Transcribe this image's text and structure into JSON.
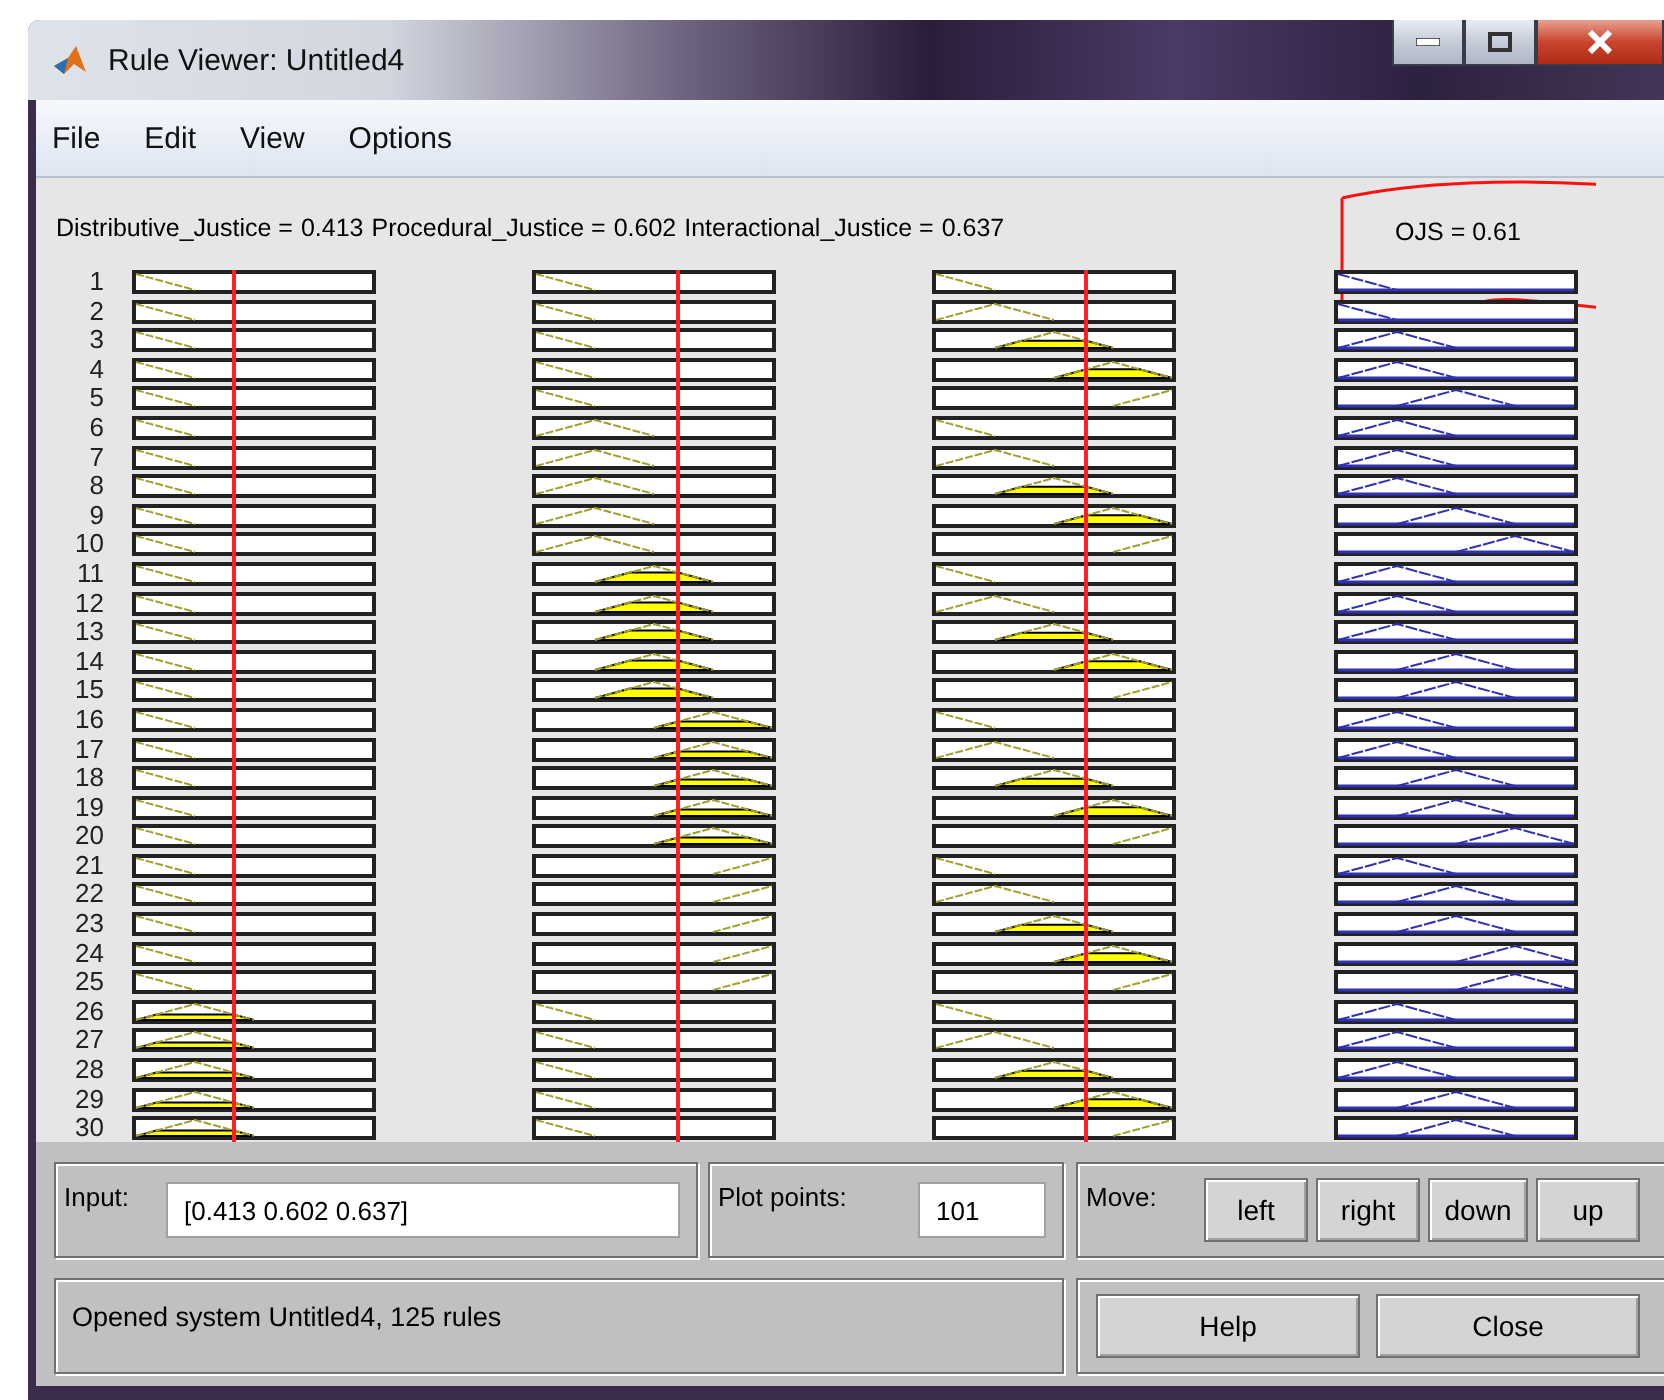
{
  "window": {
    "title": "Rule Viewer: Untitled4"
  },
  "menu": [
    "File",
    "Edit",
    "View",
    "Options"
  ],
  "variables": [
    {
      "name": "Distributive_Justice =",
      "value": "0.413"
    },
    {
      "name": "Procedural_Justice =",
      "value": "0.602"
    },
    {
      "name": "Interactional_Justice =",
      "value": "0.637"
    }
  ],
  "output": {
    "label": "OJS = 0.61"
  },
  "rules": [
    {
      "number": "1",
      "inputs": [
        {
          "kind": "low"
        },
        {
          "kind": "low"
        },
        {
          "kind": "low"
        }
      ],
      "output": {
        "kind": "low"
      }
    },
    {
      "number": "2",
      "inputs": [
        {
          "kind": "low"
        },
        {
          "kind": "low"
        },
        {
          "kind": "lower_mid"
        }
      ],
      "output": {
        "kind": "low"
      }
    },
    {
      "number": "3",
      "inputs": [
        {
          "kind": "low"
        },
        {
          "kind": "low"
        },
        {
          "kind": "mid"
        }
      ],
      "output": {
        "kind": "lower_mid"
      }
    },
    {
      "number": "4",
      "inputs": [
        {
          "kind": "low"
        },
        {
          "kind": "low"
        },
        {
          "kind": "upper_mid"
        }
      ],
      "output": {
        "kind": "lower_mid"
      }
    },
    {
      "number": "5",
      "inputs": [
        {
          "kind": "low"
        },
        {
          "kind": "low"
        },
        {
          "kind": "high"
        }
      ],
      "output": {
        "kind": "mid"
      }
    },
    {
      "number": "6",
      "inputs": [
        {
          "kind": "low"
        },
        {
          "kind": "lower_mid"
        },
        {
          "kind": "low"
        }
      ],
      "output": {
        "kind": "lower_mid"
      }
    },
    {
      "number": "7",
      "inputs": [
        {
          "kind": "low"
        },
        {
          "kind": "lower_mid"
        },
        {
          "kind": "lower_mid"
        }
      ],
      "output": {
        "kind": "lower_mid"
      }
    },
    {
      "number": "8",
      "inputs": [
        {
          "kind": "low"
        },
        {
          "kind": "lower_mid"
        },
        {
          "kind": "mid"
        }
      ],
      "output": {
        "kind": "lower_mid"
      }
    },
    {
      "number": "9",
      "inputs": [
        {
          "kind": "low"
        },
        {
          "kind": "lower_mid"
        },
        {
          "kind": "upper_mid"
        }
      ],
      "output": {
        "kind": "mid"
      }
    },
    {
      "number": "10",
      "inputs": [
        {
          "kind": "low"
        },
        {
          "kind": "lower_mid"
        },
        {
          "kind": "high"
        }
      ],
      "output": {
        "kind": "upper_mid"
      }
    },
    {
      "number": "11",
      "inputs": [
        {
          "kind": "low"
        },
        {
          "kind": "mid"
        },
        {
          "kind": "low"
        }
      ],
      "output": {
        "kind": "lower_mid"
      }
    },
    {
      "number": "12",
      "inputs": [
        {
          "kind": "low"
        },
        {
          "kind": "mid"
        },
        {
          "kind": "lower_mid"
        }
      ],
      "output": {
        "kind": "lower_mid"
      }
    },
    {
      "number": "13",
      "inputs": [
        {
          "kind": "low"
        },
        {
          "kind": "mid"
        },
        {
          "kind": "mid"
        }
      ],
      "output": {
        "kind": "lower_mid"
      }
    },
    {
      "number": "14",
      "inputs": [
        {
          "kind": "low"
        },
        {
          "kind": "mid"
        },
        {
          "kind": "upper_mid"
        }
      ],
      "output": {
        "kind": "mid"
      }
    },
    {
      "number": "15",
      "inputs": [
        {
          "kind": "low"
        },
        {
          "kind": "mid"
        },
        {
          "kind": "high"
        }
      ],
      "output": {
        "kind": "mid"
      }
    },
    {
      "number": "16",
      "inputs": [
        {
          "kind": "low"
        },
        {
          "kind": "upper_mid"
        },
        {
          "kind": "low"
        }
      ],
      "output": {
        "kind": "lower_mid"
      }
    },
    {
      "number": "17",
      "inputs": [
        {
          "kind": "low"
        },
        {
          "kind": "upper_mid"
        },
        {
          "kind": "lower_mid"
        }
      ],
      "output": {
        "kind": "lower_mid"
      }
    },
    {
      "number": "18",
      "inputs": [
        {
          "kind": "low"
        },
        {
          "kind": "upper_mid"
        },
        {
          "kind": "mid"
        }
      ],
      "output": {
        "kind": "mid"
      }
    },
    {
      "number": "19",
      "inputs": [
        {
          "kind": "low"
        },
        {
          "kind": "upper_mid"
        },
        {
          "kind": "upper_mid"
        }
      ],
      "output": {
        "kind": "mid"
      }
    },
    {
      "number": "20",
      "inputs": [
        {
          "kind": "low"
        },
        {
          "kind": "upper_mid"
        },
        {
          "kind": "high"
        }
      ],
      "output": {
        "kind": "upper_mid"
      }
    },
    {
      "number": "21",
      "inputs": [
        {
          "kind": "low"
        },
        {
          "kind": "high"
        },
        {
          "kind": "low"
        }
      ],
      "output": {
        "kind": "lower_mid"
      }
    },
    {
      "number": "22",
      "inputs": [
        {
          "kind": "low"
        },
        {
          "kind": "high"
        },
        {
          "kind": "lower_mid"
        }
      ],
      "output": {
        "kind": "mid"
      }
    },
    {
      "number": "23",
      "inputs": [
        {
          "kind": "low"
        },
        {
          "kind": "high"
        },
        {
          "kind": "mid"
        }
      ],
      "output": {
        "kind": "mid"
      }
    },
    {
      "number": "24",
      "inputs": [
        {
          "kind": "low"
        },
        {
          "kind": "high"
        },
        {
          "kind": "upper_mid"
        }
      ],
      "output": {
        "kind": "upper_mid"
      }
    },
    {
      "number": "25",
      "inputs": [
        {
          "kind": "low"
        },
        {
          "kind": "high"
        },
        {
          "kind": "high"
        }
      ],
      "output": {
        "kind": "upper_mid"
      }
    },
    {
      "number": "26",
      "inputs": [
        {
          "kind": "lower_mid"
        },
        {
          "kind": "low"
        },
        {
          "kind": "low"
        }
      ],
      "output": {
        "kind": "lower_mid"
      }
    },
    {
      "number": "27",
      "inputs": [
        {
          "kind": "lower_mid"
        },
        {
          "kind": "low"
        },
        {
          "kind": "lower_mid"
        }
      ],
      "output": {
        "kind": "lower_mid"
      }
    },
    {
      "number": "28",
      "inputs": [
        {
          "kind": "lower_mid"
        },
        {
          "kind": "low"
        },
        {
          "kind": "mid"
        }
      ],
      "output": {
        "kind": "lower_mid"
      }
    },
    {
      "number": "29",
      "inputs": [
        {
          "kind": "lower_mid"
        },
        {
          "kind": "low"
        },
        {
          "kind": "upper_mid"
        }
      ],
      "output": {
        "kind": "mid"
      }
    },
    {
      "number": "30",
      "inputs": [
        {
          "kind": "lower_mid"
        },
        {
          "kind": "low"
        },
        {
          "kind": "high"
        }
      ],
      "output": {
        "kind": "mid"
      }
    }
  ],
  "input_field": {
    "label": "Input:",
    "value": "[0.413 0.602 0.637]"
  },
  "plot_points": {
    "label": "Plot points:",
    "value": "101"
  },
  "move": {
    "label": "Move:",
    "buttons": [
      "left",
      "right",
      "down",
      "up"
    ]
  },
  "status": "Opened system Untitled4, 125 rules",
  "buttons": [
    "Help",
    "Close"
  ]
}
